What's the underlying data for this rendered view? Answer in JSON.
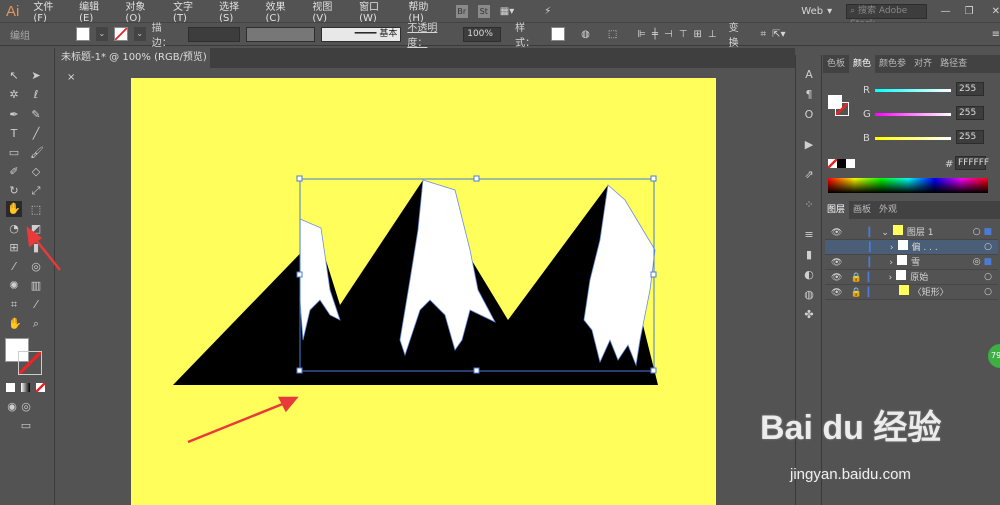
{
  "app": {
    "logo": "Ai"
  },
  "menu": [
    "文件(F)",
    "编辑(E)",
    "对象(O)",
    "文字(T)",
    "选择(S)",
    "效果(C)",
    "视图(V)",
    "窗口(W)",
    "帮助(H)"
  ],
  "menu_icons": [
    "Br",
    "St"
  ],
  "workspace": "Web",
  "search_placeholder": "搜索 Adobe Stock",
  "control": {
    "selection": "编组",
    "stroke_label": "描边：",
    "brush": "基本",
    "opacity_label": "不透明度：",
    "opacity": "100%",
    "style_label": "样式：",
    "transform": "变换"
  },
  "document_tab": {
    "title": "未标题-1* @ 100% (RGB/预览)",
    "close": "×"
  },
  "color_panel": {
    "tabs": [
      "色板",
      "颜色",
      "颜色参",
      "对齐",
      "路径查"
    ],
    "active": "颜色",
    "r_label": "R",
    "g_label": "G",
    "b_label": "B",
    "r": "255",
    "g": "255",
    "b": "255",
    "hex_label": "#",
    "hex": "FFFFFF"
  },
  "layers_panel": {
    "tabs": [
      "图层",
      "画板",
      "外观"
    ],
    "layers": [
      {
        "name": "图层 1"
      },
      {
        "name": "偏 . . ."
      },
      {
        "name": "雪"
      },
      {
        "name": "原始"
      },
      {
        "name": "〈矩形〉"
      }
    ]
  },
  "colors": {
    "artboard": "#fffe5a",
    "accent": "#4a7bd6",
    "arrow": "#e83a3a"
  },
  "watermark": {
    "brand": "Bai du 经验",
    "url": "jingyan.baidu.com"
  },
  "badge": "79"
}
